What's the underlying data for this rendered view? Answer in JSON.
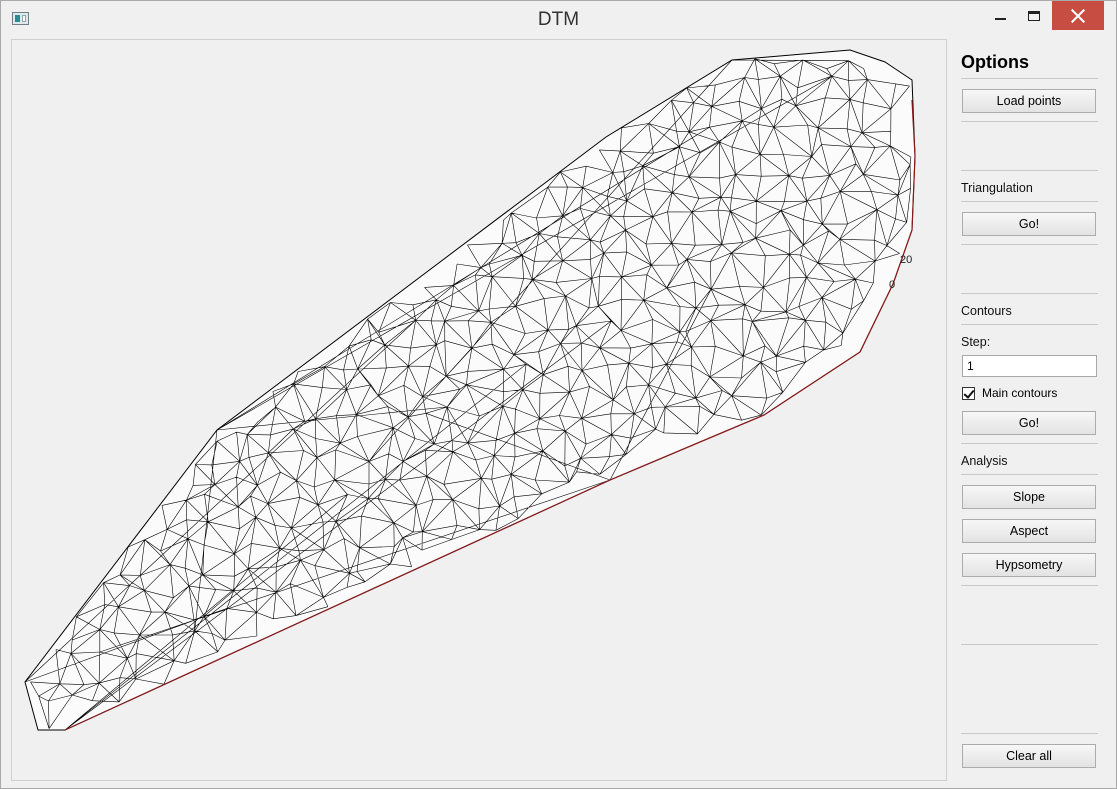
{
  "window": {
    "title": "DTM"
  },
  "canvas": {
    "scale_labels": [
      "20",
      "0"
    ]
  },
  "options": {
    "heading": "Options",
    "load_points_label": "Load points",
    "triangulation": {
      "label": "Triangulation",
      "go_label": "Go!"
    },
    "contours": {
      "label": "Contours",
      "step_label": "Step:",
      "step_value": "1",
      "main_contours_label": "Main contours",
      "main_contours_checked": true,
      "go_label": "Go!"
    },
    "analysis": {
      "label": "Analysis",
      "slope_label": "Slope",
      "aspect_label": "Aspect",
      "hypsometry_label": "Hypsometry"
    },
    "clear_all_label": "Clear all"
  }
}
